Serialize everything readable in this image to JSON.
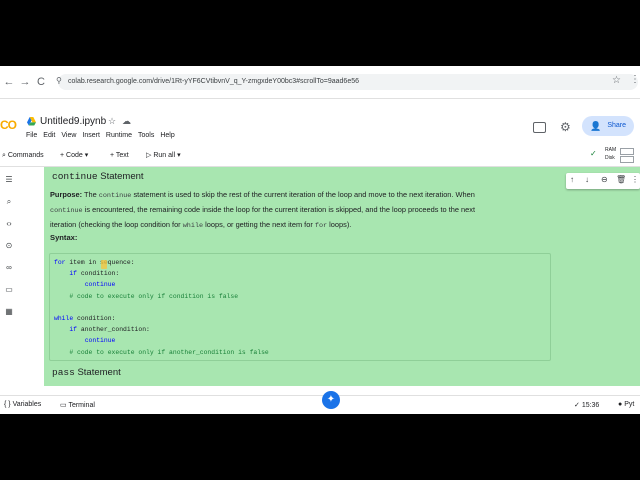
{
  "browser": {
    "back": "←",
    "forward": "→",
    "reload": "C",
    "site_info": "⚲",
    "url": "colab.research.google.com/drive/1Rt-yYF6CVtibvnV_q_Y-zmgxdeY00bc3#scrollTo=9aad6e56",
    "bookmark": "☆",
    "more": "⋮"
  },
  "header": {
    "logo": "CO",
    "notebook_title": "Untitled9.ipynb",
    "star_icon": "☆",
    "cloud_icon": "☁",
    "menu": [
      "File",
      "Edit",
      "View",
      "Insert",
      "Runtime",
      "Tools",
      "Help"
    ],
    "share_label": "Share"
  },
  "toolbar": {
    "commands": "Commands",
    "code": "+ Code",
    "code_chevron": "▾",
    "text": "+ Text",
    "run_all": "Run all",
    "run_all_chevron": "▾",
    "ram": "RAM",
    "disk": "Disk"
  },
  "cell_toolbar": [
    "↑",
    "↓",
    "⊖",
    "🗑",
    "⋮"
  ],
  "cell": {
    "heading_code": "continue",
    "heading_text": " Statement",
    "purpose_label": "Purpose:",
    "purpose_pre": " The ",
    "purpose_kw1": "continue",
    "purpose_post1": " statement is used to skip the rest of the current iteration of the loop and move to the next iteration. When",
    "purpose_kw2": "continue",
    "purpose_post2": " is encountered, the remaining code inside the loop for the current iteration is skipped, and the loop proceeds to the next",
    "purpose_post3": "iteration (checking the loop condition for ",
    "purpose_kw3": "while",
    "purpose_post4": " loops, or getting the next item for ",
    "purpose_kw4": "for",
    "purpose_post5": " loops).",
    "syntax_label": "Syntax:",
    "code_lines": [
      {
        "kw": "for",
        "rest": " item in sequence:",
        "indent": ""
      },
      {
        "kw": "if",
        "rest": " condition:",
        "indent": "    "
      },
      {
        "kw": "continue",
        "rest": "",
        "indent": "        "
      },
      {
        "comment": "# code to execute only if condition is false",
        "indent": "    "
      },
      {
        "blank": true
      },
      {
        "kw": "while",
        "rest": " condition:",
        "indent": ""
      },
      {
        "kw": "if",
        "rest": " another_condition:",
        "indent": "    "
      },
      {
        "kw": "continue",
        "rest": "",
        "indent": "        "
      },
      {
        "comment": "# code to execute only if another_condition is false",
        "indent": "    "
      }
    ],
    "next_heading_code": "pass",
    "next_heading_text": " Statement"
  },
  "statusbar": {
    "variables": "{ } Variables",
    "terminal": "Terminal",
    "time": "15:36",
    "runtime": "Pyt"
  },
  "colors": {
    "cell_bg": "#a8e6b0",
    "accent": "#0b57d0",
    "keyword": "#0000ff",
    "comment": "#188038"
  }
}
